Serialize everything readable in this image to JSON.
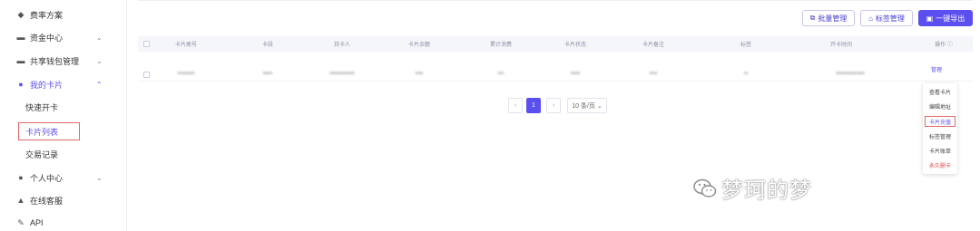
{
  "sidebar": {
    "items": [
      {
        "label": "费率方案",
        "icon": "gem-icon",
        "glyph": "◆"
      },
      {
        "label": "资金中心",
        "icon": "wallet-icon",
        "glyph": "▬",
        "chevron": "⌄"
      },
      {
        "label": "共享钱包管理",
        "icon": "shared-wallet-icon",
        "glyph": "▬",
        "chevron": "⌄"
      },
      {
        "label": "我的卡片",
        "icon": "card-icon",
        "glyph": "●",
        "chevron": "⌃"
      },
      {
        "label": "个人中心",
        "icon": "user-icon",
        "glyph": "●",
        "chevron": "⌄"
      },
      {
        "label": "在线客服",
        "icon": "service-icon",
        "glyph": "▲"
      },
      {
        "label": "API",
        "icon": "api-icon",
        "glyph": "✎"
      }
    ],
    "sub_items": [
      "快速开卡",
      "卡片列表",
      "交易记录"
    ]
  },
  "toolbar": {
    "batch_label": "批量管理",
    "tag_label": "标签管理",
    "export_label": "一键导出"
  },
  "table": {
    "columns": [
      "卡片尾号",
      "卡段",
      "持卡人",
      "卡片余额",
      "累计消费",
      "卡片状态",
      "卡片备注",
      "标签",
      "开卡时间",
      "操作 ⓘ"
    ],
    "row": {
      "cells": [
        "•••••••••",
        "•••••",
        "•••••••••••••",
        "••••",
        "•••",
        "•••••",
        "••••",
        "••",
        "•••••••••••••••"
      ],
      "action": "管理"
    }
  },
  "pagination": {
    "prev": "‹",
    "current": "1",
    "next": "›",
    "page_size": "10 条/页 ⌄"
  },
  "dropdown": {
    "items": [
      "查看卡片",
      "编辑地址",
      "卡片充值",
      "标签管理",
      "卡片账单",
      "永久删卡"
    ]
  },
  "watermark": {
    "text": "梦珂的梦"
  },
  "colors": {
    "accent": "#5b4ff0",
    "highlight_border": "#e26767",
    "danger": "#e04848"
  }
}
